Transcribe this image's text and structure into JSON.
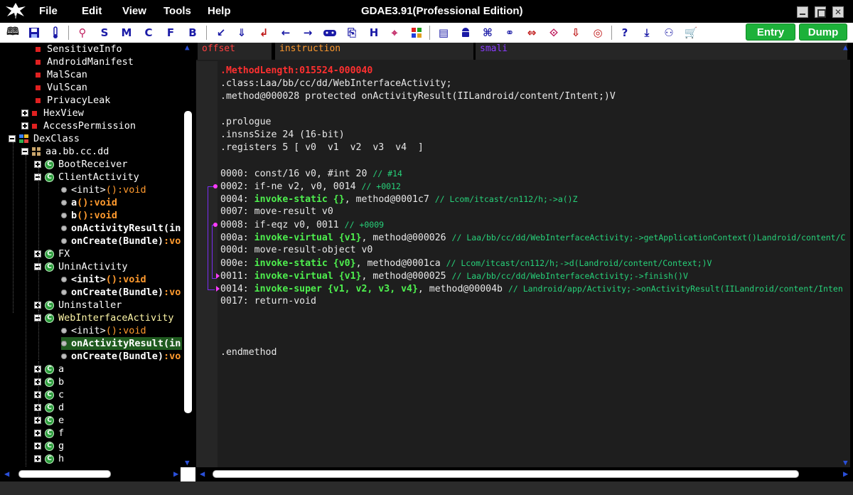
{
  "window": {
    "title": "GDAE3.91(Professional Edition)",
    "logo_text": "GDA"
  },
  "menu": [
    "File",
    "Edit",
    "View",
    "Tools",
    "Help"
  ],
  "toolbar": {
    "letter_buttons": [
      "S",
      "M",
      "C",
      "F",
      "B"
    ],
    "h_button": "H",
    "help_button": "?",
    "entry_label": "Entry",
    "dump_label": "Dump"
  },
  "tree": {
    "items": [
      {
        "label": "SensitiveInfo",
        "kind": "leaf-red"
      },
      {
        "label": "AndroidManifest",
        "kind": "leaf-red"
      },
      {
        "label": "MalScan",
        "kind": "leaf-red"
      },
      {
        "label": "VulScan",
        "kind": "leaf-red"
      },
      {
        "label": "PrivacyLeak",
        "kind": "leaf-red"
      },
      {
        "label": "HexView",
        "kind": "folder-red"
      },
      {
        "label": "AccessPermission",
        "kind": "folder-red"
      },
      {
        "label": "DexClass",
        "kind": "dex"
      },
      {
        "label": "aa.bb.cc.dd",
        "kind": "package"
      },
      {
        "label": "BootReceiver",
        "kind": "class"
      },
      {
        "label": "ClientActivity",
        "kind": "class-open"
      },
      {
        "name": "<init>",
        "sig": "():void",
        "kind": "method"
      },
      {
        "name": "a",
        "sig": "():void",
        "kind": "method-bold"
      },
      {
        "name": "b",
        "sig": "():void",
        "kind": "method-bold"
      },
      {
        "name": "onActivityResult(in",
        "sig": "",
        "kind": "method-bold"
      },
      {
        "name": "onCreate(Bundle)",
        "sig": ":vo",
        "kind": "method-bold"
      },
      {
        "label": "FX",
        "kind": "class"
      },
      {
        "label": "UninActivity",
        "kind": "class-open"
      },
      {
        "name": "<init>",
        "sig": "():void",
        "kind": "method-bold"
      },
      {
        "name": "onCreate(Bundle)",
        "sig": ":vo",
        "kind": "method-bold"
      },
      {
        "label": "Uninstaller",
        "kind": "class"
      },
      {
        "label": "WebInterfaceActivity",
        "kind": "class-open-yellow"
      },
      {
        "name": "<init>",
        "sig": "():void",
        "kind": "method"
      },
      {
        "name": "onActivityResult(in",
        "sig": "",
        "kind": "method-selected"
      },
      {
        "name": "onCreate(Bundle)",
        "sig": ":vo",
        "kind": "method-bold"
      },
      {
        "label": "a",
        "kind": "class"
      },
      {
        "label": "b",
        "kind": "class"
      },
      {
        "label": "c",
        "kind": "class"
      },
      {
        "label": "d",
        "kind": "class"
      },
      {
        "label": "e",
        "kind": "class"
      },
      {
        "label": "f",
        "kind": "class"
      },
      {
        "label": "g",
        "kind": "class"
      },
      {
        "label": "h",
        "kind": "class"
      }
    ]
  },
  "code": {
    "headers": {
      "offset": "offset",
      "instruction": "instruction",
      "smali": "smali"
    },
    "lines": [
      {
        "segs": [
          {
            "t": ".MethodLength:015524-000040",
            "c": "red"
          }
        ]
      },
      {
        "segs": [
          {
            "t": ".class:Laa/bb/cc/dd/WebInterfaceActivity;",
            "c": "white"
          }
        ]
      },
      {
        "segs": [
          {
            "t": ".method@000028 protected onActivityResult(IILandroid/content/Intent;)V",
            "c": "white"
          }
        ]
      },
      {
        "segs": []
      },
      {
        "segs": [
          {
            "t": ".prologue",
            "c": "white"
          }
        ]
      },
      {
        "segs": [
          {
            "t": ".insnsSize 24 (16-bit)",
            "c": "white"
          }
        ]
      },
      {
        "segs": [
          {
            "t": ".registers 5 [ v0  v1  v2  v3  v4  ]",
            "c": "white"
          }
        ]
      },
      {
        "segs": []
      },
      {
        "segs": [
          {
            "t": "0000: const/16 v0, #int 20 ",
            "c": "white"
          },
          {
            "t": "// #14",
            "c": "cmt"
          }
        ]
      },
      {
        "segs": [
          {
            "t": "0002: if-ne v2, v0, 0014 ",
            "c": "white"
          },
          {
            "t": "// +0012",
            "c": "cmt"
          }
        ]
      },
      {
        "segs": [
          {
            "t": "0004: ",
            "c": "white"
          },
          {
            "t": "invoke-static {}",
            "c": "green"
          },
          {
            "t": ", method@0001c7 ",
            "c": "white"
          },
          {
            "t": "// Lcom/itcast/cn112/h;->a()Z",
            "c": "cmt"
          }
        ]
      },
      {
        "segs": [
          {
            "t": "0007: move-result v0",
            "c": "white"
          }
        ]
      },
      {
        "segs": [
          {
            "t": "0008: if-eqz v0, 0011 ",
            "c": "white"
          },
          {
            "t": "// +0009",
            "c": "cmt"
          }
        ]
      },
      {
        "segs": [
          {
            "t": "000a: ",
            "c": "white"
          },
          {
            "t": "invoke-virtual {v1}",
            "c": "green"
          },
          {
            "t": ", method@000026 ",
            "c": "white"
          },
          {
            "t": "// Laa/bb/cc/dd/WebInterfaceActivity;->getApplicationContext()Landroid/content/C",
            "c": "cmt"
          }
        ]
      },
      {
        "segs": [
          {
            "t": "000d: move-result-object v0",
            "c": "white"
          }
        ]
      },
      {
        "segs": [
          {
            "t": "000e: ",
            "c": "white"
          },
          {
            "t": "invoke-static {v0}",
            "c": "green"
          },
          {
            "t": ", method@0001ca ",
            "c": "white"
          },
          {
            "t": "// Lcom/itcast/cn112/h;->d(Landroid/content/Context;)V",
            "c": "cmt"
          }
        ]
      },
      {
        "segs": [
          {
            "t": "0011: ",
            "c": "white"
          },
          {
            "t": "invoke-virtual {v1}",
            "c": "green"
          },
          {
            "t": ", method@000025 ",
            "c": "white"
          },
          {
            "t": "// Laa/bb/cc/dd/WebInterfaceActivity;->finish()V",
            "c": "cmt"
          }
        ]
      },
      {
        "segs": [
          {
            "t": "0014: ",
            "c": "white"
          },
          {
            "t": "invoke-super {v1, v2, v3, v4}",
            "c": "green"
          },
          {
            "t": ", method@00004b ",
            "c": "white"
          },
          {
            "t": "// Landroid/app/Activity;->onActivityResult(IILandroid/content/Inten",
            "c": "cmt"
          }
        ]
      },
      {
        "segs": [
          {
            "t": "0017: return-void",
            "c": "white"
          }
        ]
      },
      {
        "segs": []
      },
      {
        "segs": []
      },
      {
        "segs": []
      },
      {
        "segs": [
          {
            "t": ".endmethod",
            "c": "white"
          }
        ]
      }
    ]
  },
  "colors": {
    "accent_green": "#1db13a",
    "opcode_green": "#4ef04e",
    "comment_green": "#27d27a",
    "header_red": "#ff3030",
    "jump_line": "#7a2cf5"
  }
}
